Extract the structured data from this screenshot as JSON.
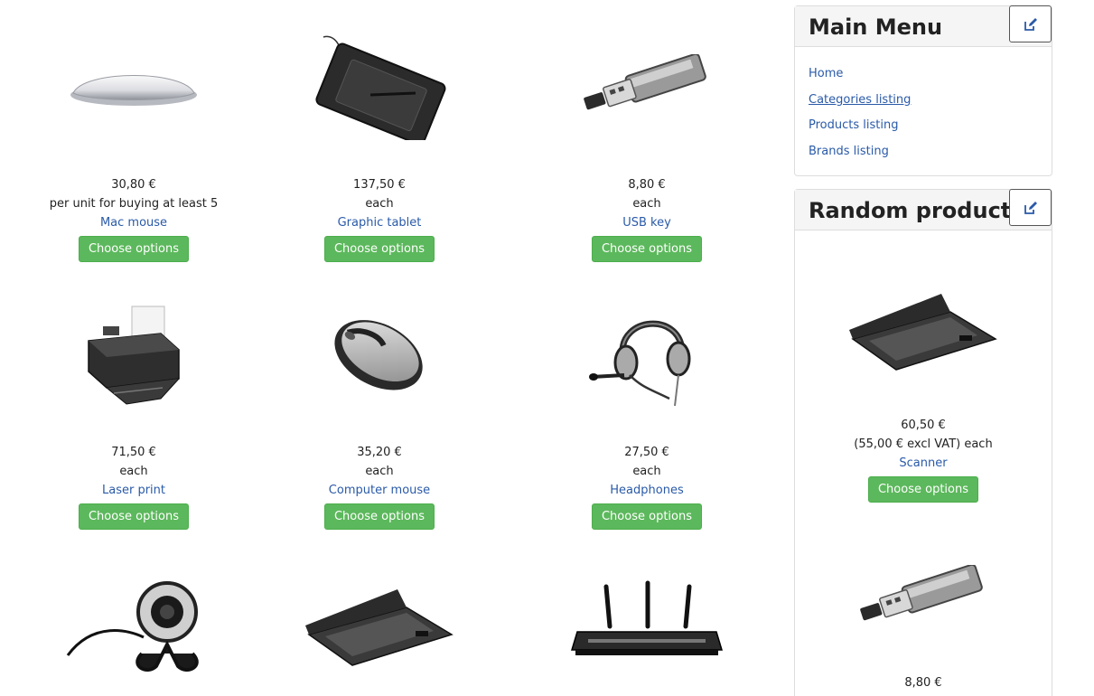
{
  "products": [
    {
      "price": "30,80 €",
      "unit": "per unit for buying at least 5",
      "name": "Mac mouse",
      "button": "Choose options",
      "icon": "mac-mouse"
    },
    {
      "price": "137,50 €",
      "unit": "each",
      "name": "Graphic tablet",
      "button": "Choose options",
      "icon": "graphic-tablet"
    },
    {
      "price": "8,80 €",
      "unit": "each",
      "name": "USB key",
      "button": "Choose options",
      "icon": "usb-key"
    },
    {
      "price": "71,50 €",
      "unit": "each",
      "name": "Laser print",
      "button": "Choose options",
      "icon": "printer"
    },
    {
      "price": "35,20 €",
      "unit": "each",
      "name": "Computer mouse",
      "button": "Choose options",
      "icon": "computer-mouse"
    },
    {
      "price": "27,50 €",
      "unit": "each",
      "name": "Headphones",
      "button": "Choose options",
      "icon": "headphones"
    },
    {
      "icon": "webcam"
    },
    {
      "icon": "scanner"
    },
    {
      "icon": "router"
    }
  ],
  "sidebar": {
    "main_menu": {
      "title": "Main Menu",
      "items": [
        {
          "label": "Home"
        },
        {
          "label": "Categories listing"
        },
        {
          "label": "Products listing"
        },
        {
          "label": "Brands listing"
        }
      ]
    },
    "random_products": {
      "title": "Random products",
      "items": [
        {
          "price": "60,50 €",
          "unit": "(55,00 € excl VAT) each",
          "name": "Scanner",
          "button": "Choose options",
          "icon": "scanner"
        },
        {
          "price": "8,80 €",
          "icon": "usb-key"
        }
      ]
    }
  },
  "colors": {
    "link": "#2a5aa8",
    "button_green": "#5cb85c",
    "panel_header_bg": "#f5f5f5",
    "border": "#dddddd"
  }
}
